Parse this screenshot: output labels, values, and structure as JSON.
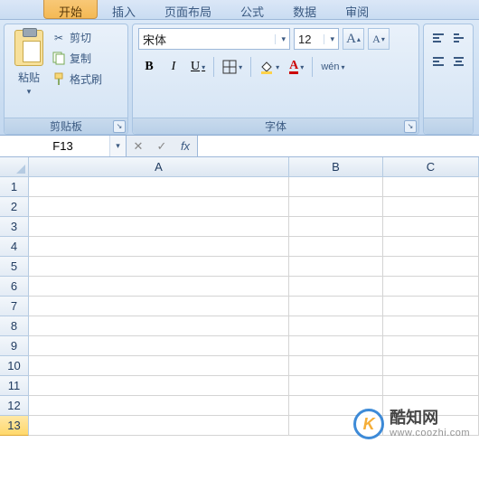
{
  "tabs": {
    "active": "开始",
    "t1": "插入",
    "t2": "页面布局",
    "t3": "公式",
    "t4": "数据",
    "t5": "审阅"
  },
  "clipboard": {
    "paste": "粘贴",
    "cut": "剪切",
    "copy": "复制",
    "format_painter": "格式刷",
    "group_label": "剪贴板"
  },
  "font": {
    "name": "宋体",
    "size": "12",
    "group_label": "字体",
    "bold": "B",
    "italic": "I",
    "underline": "U",
    "wen": "wén"
  },
  "grow_a": "A",
  "shrink_a": "A",
  "namebox": {
    "value": "F13"
  },
  "columns": [
    "A",
    "B",
    "C"
  ],
  "rows": [
    "1",
    "2",
    "3",
    "4",
    "5",
    "6",
    "7",
    "8",
    "9",
    "10",
    "11",
    "12",
    "13"
  ],
  "active_row": "13",
  "watermark": {
    "cn": "酷知网",
    "url": "www.coozhi.com",
    "k": "K"
  }
}
